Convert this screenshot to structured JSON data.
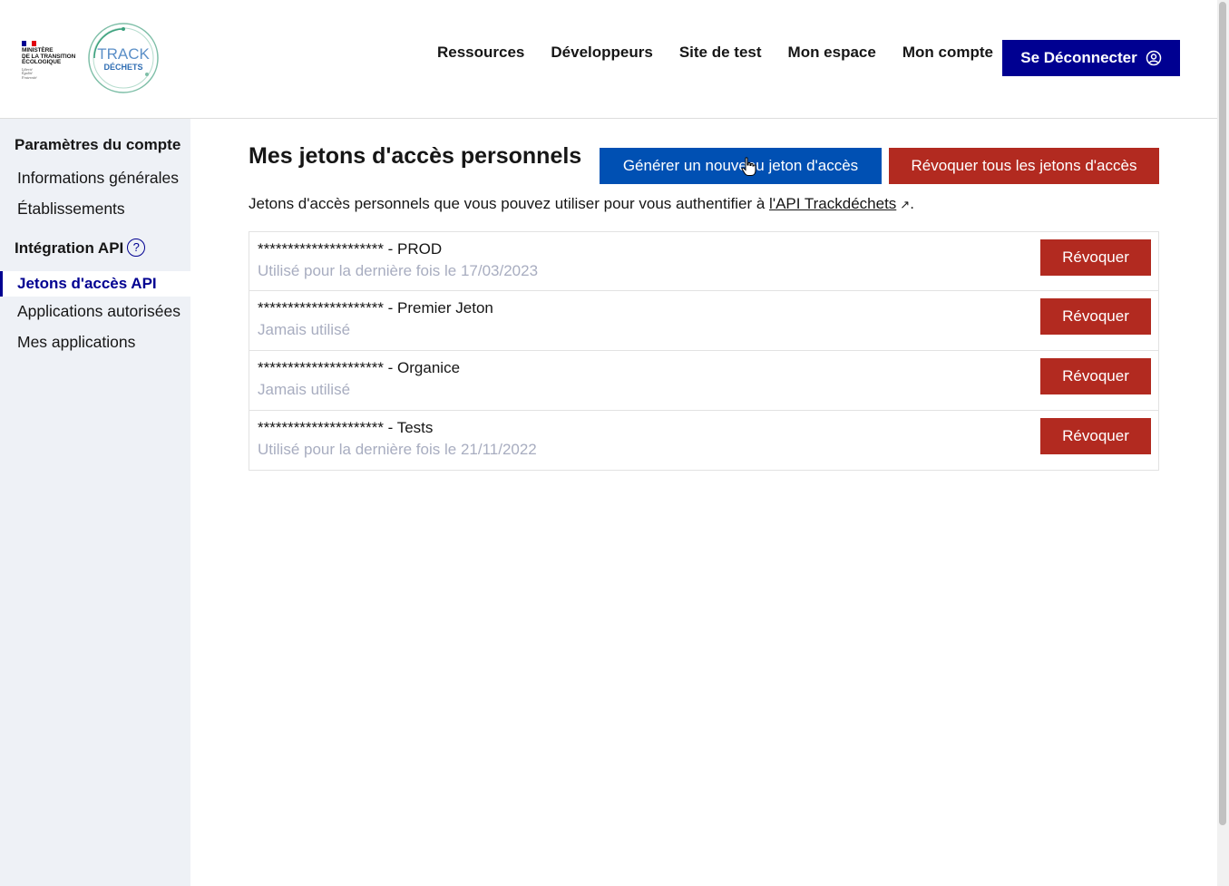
{
  "header": {
    "ministry": {
      "line1": "MINISTÈRE",
      "line2": "DE LA TRANSITION",
      "line3": "ÉCOLOGIQUE",
      "devise1": "Liberté",
      "devise2": "Égalité",
      "devise3": "Fraternité"
    },
    "logo": {
      "line1": "TRACK",
      "line2": "DÉCHETS"
    },
    "nav": [
      "Ressources",
      "Développeurs",
      "Site de test",
      "Mon espace",
      "Mon compte"
    ],
    "logout_label": "Se Déconnecter"
  },
  "sidebar": {
    "section1_title": "Paramètres du compte",
    "section1_items": [
      "Informations générales",
      "Établissements"
    ],
    "section2_title": "Intégration API",
    "help_symbol": "?",
    "active_item": "Jetons d'accès API",
    "section2_items": [
      "Applications autorisées",
      "Mes applications"
    ]
  },
  "main": {
    "title": "Mes jetons d'accès personnels",
    "generate_button": "Générer un nouveau jeton d'accès",
    "revoke_all_button": "Révoquer tous les jetons d'accès",
    "intro_text": "Jetons d'accès personnels que vous pouvez utiliser pour vous authentifier à ",
    "intro_link": "l'API Trackdéchets",
    "intro_end": ".",
    "tokens": [
      {
        "name": "********************* - PROD",
        "usage": "Utilisé pour la dernière fois le 17/03/2023",
        "revoke": "Révoquer"
      },
      {
        "name": "********************* - Premier Jeton",
        "usage": "Jamais utilisé",
        "revoke": "Révoquer"
      },
      {
        "name": "********************* - Organice",
        "usage": "Jamais utilisé",
        "revoke": "Révoquer"
      },
      {
        "name": "********************* - Tests",
        "usage": "Utilisé pour la dernière fois le 21/11/2022",
        "revoke": "Révoquer"
      }
    ]
  },
  "colors": {
    "primary_blue": "#000091",
    "action_blue": "#0050b3",
    "danger_red": "#b22a20",
    "sidebar_bg": "#eef1f6",
    "muted_text": "#a8adc0"
  }
}
